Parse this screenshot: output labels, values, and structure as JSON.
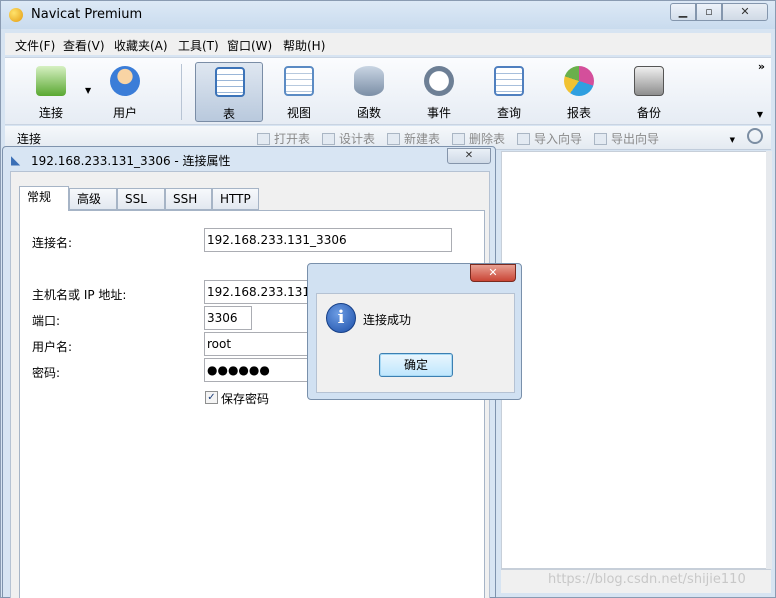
{
  "window": {
    "title": "Navicat Premium"
  },
  "menu": [
    {
      "label": "文件(F)"
    },
    {
      "label": "查看(V)"
    },
    {
      "label": "收藏夹(A)"
    },
    {
      "label": "工具(T)"
    },
    {
      "label": "窗口(W)"
    },
    {
      "label": "帮助(H)"
    }
  ],
  "toolbar": {
    "buttons": [
      {
        "label": "连接",
        "icon": "plug-icon",
        "color": "#5aa832"
      },
      {
        "label": "用户",
        "icon": "user-icon",
        "color": "#e6a35a"
      },
      {
        "label": "表",
        "icon": "table-icon",
        "color": "#3c73b8",
        "active": true
      },
      {
        "label": "视图",
        "icon": "view-icon",
        "color": "#5b8bc4"
      },
      {
        "label": "函数",
        "icon": "function-icon",
        "color": "#f0a020"
      },
      {
        "label": "事件",
        "icon": "clock-icon",
        "color": "#6d7f95"
      },
      {
        "label": "查询",
        "icon": "query-icon",
        "color": "#4f7fbf"
      },
      {
        "label": "报表",
        "icon": "report-icon",
        "color": "#d44f9b"
      },
      {
        "label": "备份",
        "icon": "backup-icon",
        "color": "#6b6b6b"
      }
    ],
    "more": "»"
  },
  "subbar": {
    "title": "连接",
    "actions": [
      {
        "label": "打开表"
      },
      {
        "label": "设计表"
      },
      {
        "label": "新建表"
      },
      {
        "label": "删除表"
      },
      {
        "label": "导入向导"
      },
      {
        "label": "导出向导"
      }
    ]
  },
  "dialog": {
    "title": "192.168.233.131_3306 - 连接属性",
    "tabs": [
      {
        "label": "常规",
        "active": true
      },
      {
        "label": "高级"
      },
      {
        "label": "SSL"
      },
      {
        "label": "SSH"
      },
      {
        "label": "HTTP"
      }
    ],
    "fields": {
      "connection_name_label": "连接名:",
      "connection_name_value": "192.168.233.131_3306",
      "host_label": "主机名或 IP 地址:",
      "host_value": "192.168.233.131",
      "port_label": "端口:",
      "port_value": "3306",
      "user_label": "用户名:",
      "user_value": "root",
      "password_label": "密码:",
      "password_value": "●●●●●●",
      "save_password_label": "保存密码",
      "save_password_checked": true
    }
  },
  "alert": {
    "message": "连接成功",
    "ok_label": "确定"
  },
  "watermark": "https://blog.csdn.net/shijie110"
}
